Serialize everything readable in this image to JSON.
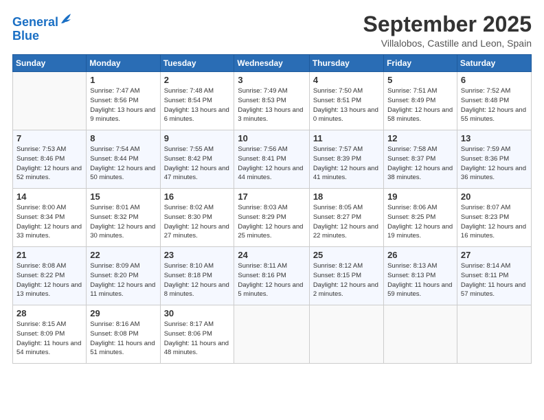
{
  "header": {
    "logo_line1": "General",
    "logo_line2": "Blue",
    "month": "September 2025",
    "location": "Villalobos, Castille and Leon, Spain"
  },
  "weekdays": [
    "Sunday",
    "Monday",
    "Tuesday",
    "Wednesday",
    "Thursday",
    "Friday",
    "Saturday"
  ],
  "weeks": [
    [
      {
        "day": "",
        "sunrise": "",
        "sunset": "",
        "daylight": ""
      },
      {
        "day": "1",
        "sunrise": "Sunrise: 7:47 AM",
        "sunset": "Sunset: 8:56 PM",
        "daylight": "Daylight: 13 hours and 9 minutes."
      },
      {
        "day": "2",
        "sunrise": "Sunrise: 7:48 AM",
        "sunset": "Sunset: 8:54 PM",
        "daylight": "Daylight: 13 hours and 6 minutes."
      },
      {
        "day": "3",
        "sunrise": "Sunrise: 7:49 AM",
        "sunset": "Sunset: 8:53 PM",
        "daylight": "Daylight: 13 hours and 3 minutes."
      },
      {
        "day": "4",
        "sunrise": "Sunrise: 7:50 AM",
        "sunset": "Sunset: 8:51 PM",
        "daylight": "Daylight: 13 hours and 0 minutes."
      },
      {
        "day": "5",
        "sunrise": "Sunrise: 7:51 AM",
        "sunset": "Sunset: 8:49 PM",
        "daylight": "Daylight: 12 hours and 58 minutes."
      },
      {
        "day": "6",
        "sunrise": "Sunrise: 7:52 AM",
        "sunset": "Sunset: 8:48 PM",
        "daylight": "Daylight: 12 hours and 55 minutes."
      }
    ],
    [
      {
        "day": "7",
        "sunrise": "Sunrise: 7:53 AM",
        "sunset": "Sunset: 8:46 PM",
        "daylight": "Daylight: 12 hours and 52 minutes."
      },
      {
        "day": "8",
        "sunrise": "Sunrise: 7:54 AM",
        "sunset": "Sunset: 8:44 PM",
        "daylight": "Daylight: 12 hours and 50 minutes."
      },
      {
        "day": "9",
        "sunrise": "Sunrise: 7:55 AM",
        "sunset": "Sunset: 8:42 PM",
        "daylight": "Daylight: 12 hours and 47 minutes."
      },
      {
        "day": "10",
        "sunrise": "Sunrise: 7:56 AM",
        "sunset": "Sunset: 8:41 PM",
        "daylight": "Daylight: 12 hours and 44 minutes."
      },
      {
        "day": "11",
        "sunrise": "Sunrise: 7:57 AM",
        "sunset": "Sunset: 8:39 PM",
        "daylight": "Daylight: 12 hours and 41 minutes."
      },
      {
        "day": "12",
        "sunrise": "Sunrise: 7:58 AM",
        "sunset": "Sunset: 8:37 PM",
        "daylight": "Daylight: 12 hours and 38 minutes."
      },
      {
        "day": "13",
        "sunrise": "Sunrise: 7:59 AM",
        "sunset": "Sunset: 8:36 PM",
        "daylight": "Daylight: 12 hours and 36 minutes."
      }
    ],
    [
      {
        "day": "14",
        "sunrise": "Sunrise: 8:00 AM",
        "sunset": "Sunset: 8:34 PM",
        "daylight": "Daylight: 12 hours and 33 minutes."
      },
      {
        "day": "15",
        "sunrise": "Sunrise: 8:01 AM",
        "sunset": "Sunset: 8:32 PM",
        "daylight": "Daylight: 12 hours and 30 minutes."
      },
      {
        "day": "16",
        "sunrise": "Sunrise: 8:02 AM",
        "sunset": "Sunset: 8:30 PM",
        "daylight": "Daylight: 12 hours and 27 minutes."
      },
      {
        "day": "17",
        "sunrise": "Sunrise: 8:03 AM",
        "sunset": "Sunset: 8:29 PM",
        "daylight": "Daylight: 12 hours and 25 minutes."
      },
      {
        "day": "18",
        "sunrise": "Sunrise: 8:05 AM",
        "sunset": "Sunset: 8:27 PM",
        "daylight": "Daylight: 12 hours and 22 minutes."
      },
      {
        "day": "19",
        "sunrise": "Sunrise: 8:06 AM",
        "sunset": "Sunset: 8:25 PM",
        "daylight": "Daylight: 12 hours and 19 minutes."
      },
      {
        "day": "20",
        "sunrise": "Sunrise: 8:07 AM",
        "sunset": "Sunset: 8:23 PM",
        "daylight": "Daylight: 12 hours and 16 minutes."
      }
    ],
    [
      {
        "day": "21",
        "sunrise": "Sunrise: 8:08 AM",
        "sunset": "Sunset: 8:22 PM",
        "daylight": "Daylight: 12 hours and 13 minutes."
      },
      {
        "day": "22",
        "sunrise": "Sunrise: 8:09 AM",
        "sunset": "Sunset: 8:20 PM",
        "daylight": "Daylight: 12 hours and 11 minutes."
      },
      {
        "day": "23",
        "sunrise": "Sunrise: 8:10 AM",
        "sunset": "Sunset: 8:18 PM",
        "daylight": "Daylight: 12 hours and 8 minutes."
      },
      {
        "day": "24",
        "sunrise": "Sunrise: 8:11 AM",
        "sunset": "Sunset: 8:16 PM",
        "daylight": "Daylight: 12 hours and 5 minutes."
      },
      {
        "day": "25",
        "sunrise": "Sunrise: 8:12 AM",
        "sunset": "Sunset: 8:15 PM",
        "daylight": "Daylight: 12 hours and 2 minutes."
      },
      {
        "day": "26",
        "sunrise": "Sunrise: 8:13 AM",
        "sunset": "Sunset: 8:13 PM",
        "daylight": "Daylight: 11 hours and 59 minutes."
      },
      {
        "day": "27",
        "sunrise": "Sunrise: 8:14 AM",
        "sunset": "Sunset: 8:11 PM",
        "daylight": "Daylight: 11 hours and 57 minutes."
      }
    ],
    [
      {
        "day": "28",
        "sunrise": "Sunrise: 8:15 AM",
        "sunset": "Sunset: 8:09 PM",
        "daylight": "Daylight: 11 hours and 54 minutes."
      },
      {
        "day": "29",
        "sunrise": "Sunrise: 8:16 AM",
        "sunset": "Sunset: 8:08 PM",
        "daylight": "Daylight: 11 hours and 51 minutes."
      },
      {
        "day": "30",
        "sunrise": "Sunrise: 8:17 AM",
        "sunset": "Sunset: 8:06 PM",
        "daylight": "Daylight: 11 hours and 48 minutes."
      },
      {
        "day": "",
        "sunrise": "",
        "sunset": "",
        "daylight": ""
      },
      {
        "day": "",
        "sunrise": "",
        "sunset": "",
        "daylight": ""
      },
      {
        "day": "",
        "sunrise": "",
        "sunset": "",
        "daylight": ""
      },
      {
        "day": "",
        "sunrise": "",
        "sunset": "",
        "daylight": ""
      }
    ]
  ]
}
